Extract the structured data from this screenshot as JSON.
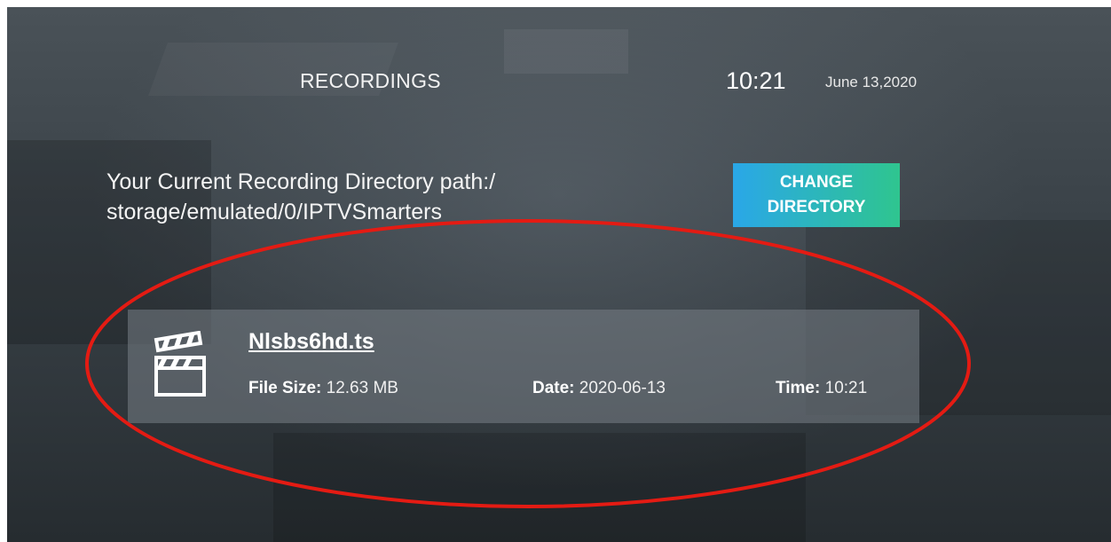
{
  "header": {
    "title": "RECORDINGS",
    "clock_time": "10:21",
    "clock_date": "June 13,2020"
  },
  "directory": {
    "label_line1": "Your Current Recording Directory path:/",
    "label_line2": "storage/emulated/0/IPTVSmarters",
    "change_button_line1": "CHANGE",
    "change_button_line2": "DIRECTORY"
  },
  "recordings": [
    {
      "icon": "clapperboard-icon",
      "name": "Nlsbs6hd.ts",
      "file_size_label": "File Size:",
      "file_size_value": "12.63 MB",
      "date_label": "Date:",
      "date_value": "2020-06-13",
      "time_label": "Time:",
      "time_value": "10:21"
    }
  ],
  "colors": {
    "button_gradient_start": "#2aa7e8",
    "button_gradient_end": "#2fc58f",
    "annotation_circle": "#e41b13"
  }
}
